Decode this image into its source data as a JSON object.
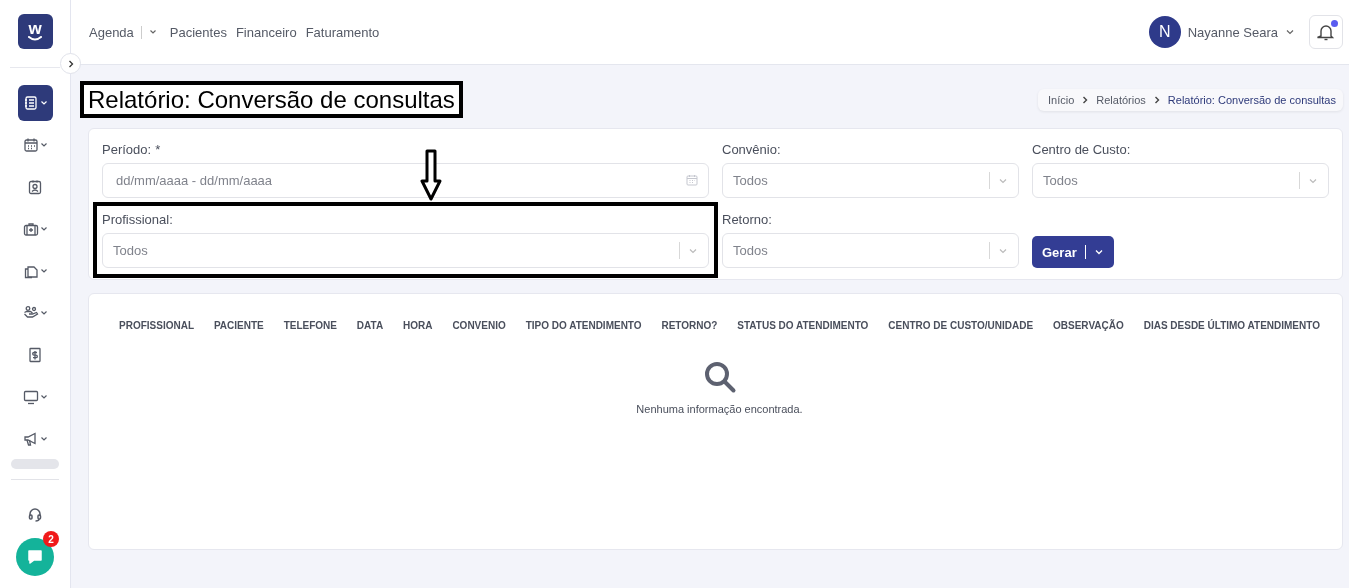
{
  "logo": {
    "letter": "w"
  },
  "topnav": {
    "items": [
      {
        "label": "Agenda",
        "has_menu": true
      },
      {
        "label": "Pacientes",
        "has_menu": false
      },
      {
        "label": "Financeiro",
        "has_menu": false
      },
      {
        "label": "Faturamento",
        "has_menu": false
      }
    ]
  },
  "user": {
    "initial": "N",
    "name": "Nayanne Seara"
  },
  "notifications": {
    "unread": true
  },
  "sidebar": {
    "items": [
      {
        "selected": true,
        "expandable": true
      },
      {
        "selected": false,
        "expandable": true
      },
      {
        "selected": false,
        "expandable": false
      },
      {
        "selected": false,
        "expandable": true
      },
      {
        "selected": false,
        "expandable": true
      },
      {
        "selected": false,
        "expandable": true
      },
      {
        "selected": false,
        "expandable": false
      },
      {
        "selected": false,
        "expandable": true
      },
      {
        "selected": false,
        "expandable": true
      }
    ]
  },
  "chat": {
    "badge": "2"
  },
  "page": {
    "title": "Relatório: Conversão de consultas",
    "breadcrumb": [
      {
        "label": "Início",
        "current": false
      },
      {
        "label": "Relatórios",
        "current": false
      },
      {
        "label": "Relatório: Conversão de consultas",
        "current": true
      }
    ]
  },
  "filters": [
    {
      "kind": "date",
      "label": "Período:",
      "required": true,
      "required_mark": "*",
      "placeholder": "dd/mm/aaaa - dd/mm/aaaa"
    },
    {
      "kind": "select",
      "label": "Convênio:",
      "required": false,
      "value": "Todos"
    },
    {
      "kind": "select",
      "label": "Centro de Custo:",
      "required": false,
      "value": "Todos"
    },
    {
      "kind": "select",
      "label": "Profissional:",
      "required": false,
      "value": "Todos"
    },
    {
      "kind": "select",
      "label": "Retorno:",
      "required": false,
      "value": "Todos"
    }
  ],
  "generate_button": {
    "label": "Gerar"
  },
  "table": {
    "columns": [
      "PROFISSIONAL",
      "PACIENTE",
      "TELEFONE",
      "DATA",
      "HORA",
      "CONVENIO",
      "TIPO DO ATENDIMENTO",
      "RETORNO?",
      "STATUS DO ATENDIMENTO",
      "CENTRO DE CUSTO/UNIDADE",
      "OBSERVAÇÃO",
      "DIAS DESDE ÚLTIMO ATENDIMENTO"
    ],
    "empty_message": "Nenhuma informação encontrada."
  }
}
